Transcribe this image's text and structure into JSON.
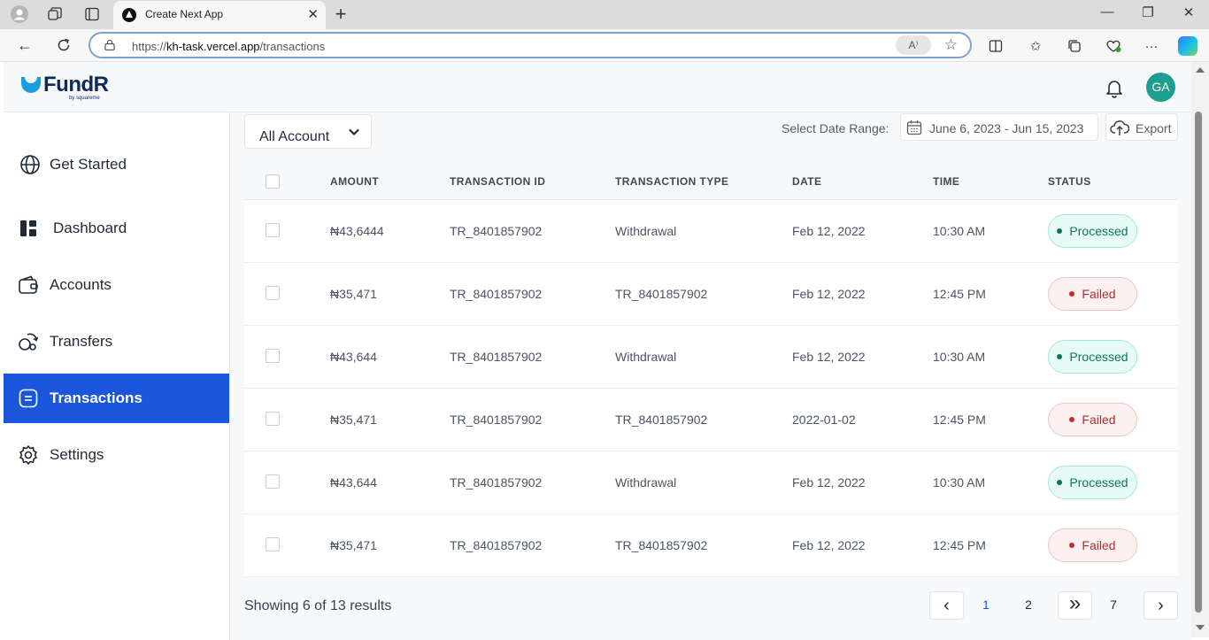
{
  "browser": {
    "tab_title": "Create Next App",
    "url_prefix": "https://",
    "url_host": "kh-task.vercel.app",
    "url_path": "/transactions",
    "read_aloud": "A⁾"
  },
  "header": {
    "logo": "FundR",
    "logo_sub": "by squareme",
    "avatar_initials": "GA"
  },
  "sidebar": {
    "items": [
      {
        "label": "Get Started",
        "icon": "globe-icon"
      },
      {
        "label": "Dashboard",
        "icon": "dashboard-icon"
      },
      {
        "label": "Accounts",
        "icon": "wallet-icon"
      },
      {
        "label": "Transfers",
        "icon": "transfer-icon"
      },
      {
        "label": "Transactions",
        "icon": "transactions-icon",
        "active": true
      },
      {
        "label": "Settings",
        "icon": "gear-icon"
      }
    ]
  },
  "toolbar": {
    "account_select": "All Account",
    "date_label": "Select Date Range:",
    "date_range": "June 6, 2023 - Jun 15, 2023",
    "export_label": "Export"
  },
  "table": {
    "columns": [
      "AMOUNT",
      "TRANSACTION ID",
      "TRANSACTION TYPE",
      "DATE",
      "TIME",
      "STATUS"
    ],
    "rows": [
      {
        "amount": "₦43,6444",
        "id": "TR_8401857902",
        "type": "Withdrawal",
        "date": "Feb 12, 2022",
        "time": "10:30 AM",
        "status": "Processed"
      },
      {
        "amount": "₦35,471",
        "id": "TR_8401857902",
        "type": "TR_8401857902",
        "date": "Feb 12, 2022",
        "time": "12:45 PM",
        "status": "Failed"
      },
      {
        "amount": "₦43,644",
        "id": "TR_8401857902",
        "type": "Withdrawal",
        "date": "Feb 12, 2022",
        "time": "10:30 AM",
        "status": "Processed"
      },
      {
        "amount": "₦35,471",
        "id": "TR_8401857902",
        "type": "TR_8401857902",
        "date": "2022-01-02",
        "time": "12:45 PM",
        "status": "Failed"
      },
      {
        "amount": "₦43,644",
        "id": "TR_8401857902",
        "type": "Withdrawal",
        "date": "Feb 12, 2022",
        "time": "10:30 AM",
        "status": "Processed"
      },
      {
        "amount": "₦35,471",
        "id": "TR_8401857902",
        "type": "TR_8401857902",
        "date": "Feb 12, 2022",
        "time": "12:45 PM",
        "status": "Failed"
      }
    ]
  },
  "pagination": {
    "summary": "Showing 6 of 13 results",
    "prev": "‹",
    "next": "›",
    "jump": "»",
    "pages": [
      "1",
      "2",
      "7"
    ],
    "current_page": "1"
  },
  "colors": {
    "primary": "#1a56db",
    "processed_bg": "#e6fbf6",
    "processed_text": "#12735f",
    "failed_bg": "#fdf0f0",
    "failed_text": "#a83131",
    "avatar": "#1e9e8e"
  }
}
